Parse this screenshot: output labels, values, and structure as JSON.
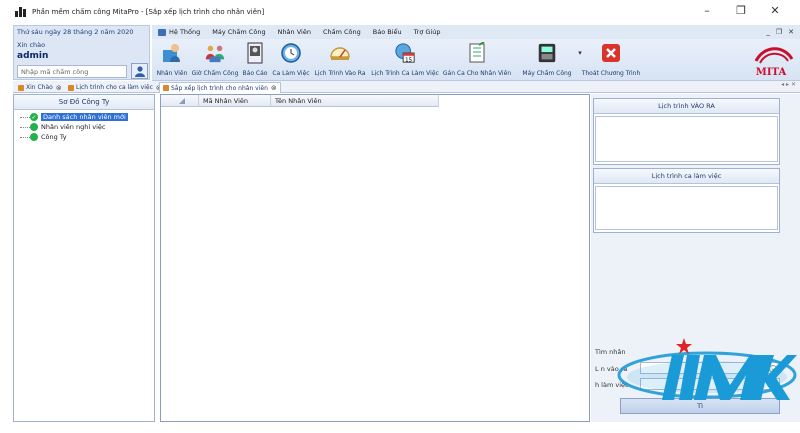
{
  "window": {
    "title": "Phần mềm chấm công MitaPro - [Sắp xếp lịch trình cho nhân viên]",
    "controls": [
      "–",
      "❐",
      "✕"
    ]
  },
  "info": {
    "date": "Thứ sáu ngày 28 tháng 2 năm 2020",
    "greeting": "Xin chào",
    "username": "admin",
    "code_placeholder": "Nhập mã chấm công"
  },
  "menu": {
    "items": [
      "Hệ Thống",
      "Máy Chấm Công",
      "Nhân Viên",
      "Chấm Công",
      "Báo Biểu",
      "Trợ Giúp"
    ],
    "mdi_controls": [
      "_",
      "❐",
      "✕"
    ]
  },
  "toolbar": {
    "buttons": [
      "Nhân Viên",
      "Giờ Chấm Công",
      "Báo Cáo",
      "Ca Làm Việc",
      "Lịch Trình Vào Ra",
      "Lịch Trình Ca Làm Việc",
      "Gán Ca Cho Nhân Viên",
      "Máy Chấm Công",
      "Thoát Chương Trình"
    ],
    "calendar_day": "15",
    "logo": "MITA"
  },
  "tabs": {
    "items": [
      "Xin Chào",
      "Lịch trình cho ca làm việc",
      "Sắp xếp lịch trình cho nhân viên"
    ],
    "nav": "◂ ▸ ✕"
  },
  "tree": {
    "header": "Sơ Đồ Công Ty",
    "nodes": [
      "Danh sách nhân viên mới",
      "Nhân viên nghỉ việc",
      "Công Ty"
    ]
  },
  "grid": {
    "columns": [
      "Mã Nhân Viên",
      "Tên Nhân Viên"
    ]
  },
  "right": {
    "panel1": "Lịch trình VÀO RA",
    "panel2": "Lịch trình ca làm việc",
    "search_label": "Tìm nhân",
    "label_inout": "L         n vào ra",
    "label_shift": "           h làm việc",
    "find_button": "                                  Tì"
  }
}
